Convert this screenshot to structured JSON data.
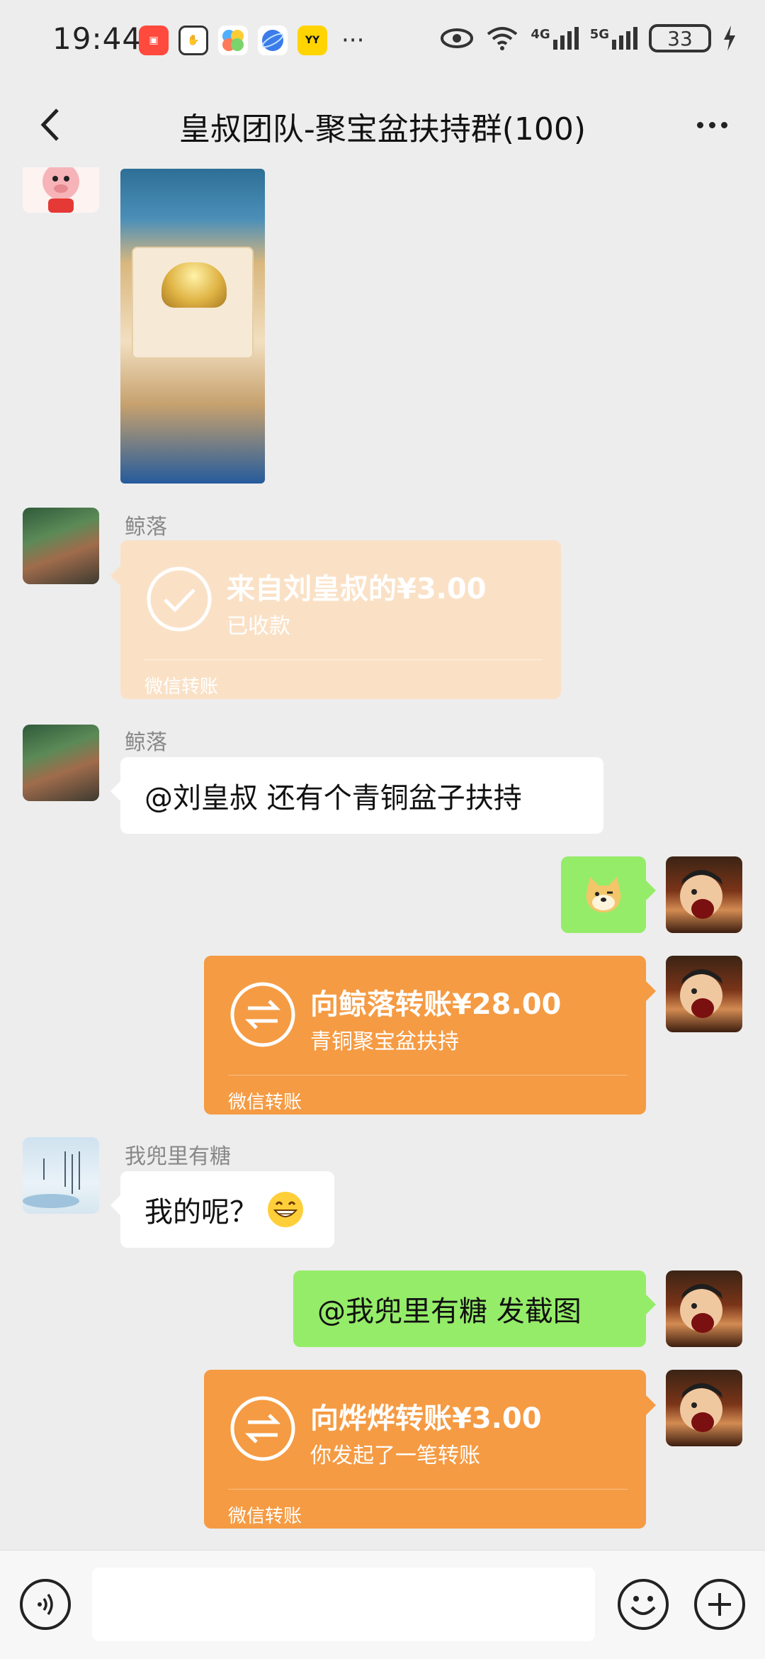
{
  "status_bar": {
    "time": "19:44",
    "battery": "33",
    "network_labels": [
      "4G",
      "5G"
    ],
    "app_icons": [
      "kuaishou-icon",
      "hand-icon",
      "pinwheel-icon",
      "browser-icon",
      "yy-icon"
    ],
    "yy_label": "YY"
  },
  "nav": {
    "title": "皇叔团队-聚宝盆扶持群(100)"
  },
  "messages": {
    "m2": {
      "sender": "鲸落",
      "title": "来自刘皇叔的¥3.00",
      "status": "已收款",
      "footer": "微信转账"
    },
    "m3": {
      "sender": "鲸落",
      "text": "@刘皇叔  还有个青铜盆子扶持"
    },
    "m5": {
      "title": "向鲸落转账¥28.00",
      "note": "青铜聚宝盆扶持",
      "footer": "微信转账"
    },
    "m6": {
      "sender": "我兜里有糖",
      "text": "我的呢？"
    },
    "m7": {
      "text": "@我兜里有糖  发截图"
    },
    "m8": {
      "title": "向烨烨转账¥3.00",
      "note": "你发起了一笔转账",
      "footer": "微信转账"
    }
  },
  "input": {
    "placeholder": ""
  },
  "colors": {
    "background": "#ededed",
    "green_bubble": "#95ec69",
    "transfer_orange": "#f59b43",
    "transfer_received": "#fae1c6"
  }
}
